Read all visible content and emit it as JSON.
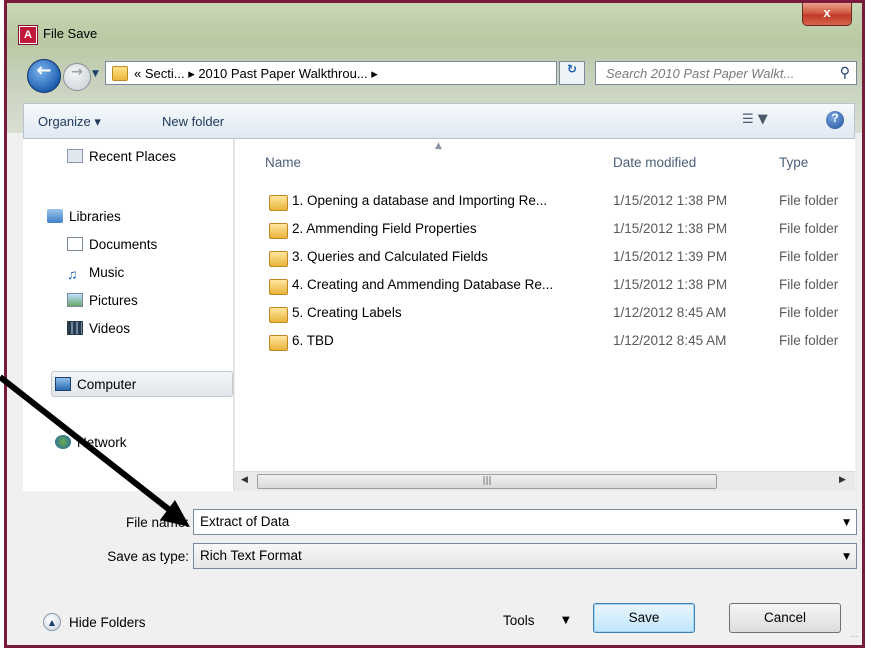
{
  "window": {
    "title": "File Save",
    "app_icon_letter": "A",
    "close_label": "x"
  },
  "address": {
    "path": "« Secti... ▸ 2010 Past Paper Walkthrou... ▸",
    "search_placeholder": "Search 2010 Past Paper Walkt..."
  },
  "toolbar": {
    "organize_label": "Organize ▾",
    "new_folder_label": "New folder"
  },
  "nav": {
    "recent_places": "Recent Places",
    "libraries": "Libraries",
    "documents": "Documents",
    "music": "Music",
    "pictures": "Pictures",
    "videos": "Videos",
    "computer": "Computer",
    "network": "Network"
  },
  "columns": {
    "name": "Name",
    "date_modified": "Date modified",
    "type": "Type"
  },
  "files": [
    {
      "name": "1. Opening a database and Importing Re...",
      "date": "1/15/2012 1:38 PM",
      "type": "File folder"
    },
    {
      "name": "2. Ammending Field Properties",
      "date": "1/15/2012 1:38 PM",
      "type": "File folder"
    },
    {
      "name": "3. Queries and Calculated Fields",
      "date": "1/15/2012 1:39 PM",
      "type": "File folder"
    },
    {
      "name": "4. Creating and Ammending Database Re...",
      "date": "1/15/2012 1:38 PM",
      "type": "File folder"
    },
    {
      "name": "5. Creating Labels",
      "date": "1/12/2012 8:45 AM",
      "type": "File folder"
    },
    {
      "name": "6. TBD",
      "date": "1/12/2012 8:45 AM",
      "type": "File folder"
    }
  ],
  "form": {
    "file_name_label": "File name:",
    "file_name_value": "Extract of Data",
    "save_type_label": "Save as type:",
    "save_type_value": "Rich Text Format"
  },
  "footer": {
    "hide_folders_label": "Hide Folders",
    "tools_label": "Tools",
    "save_label": "Save",
    "cancel_label": "Cancel"
  },
  "colors": {
    "frame_border": "#7a1a3a",
    "annotation_arrow": "#000000",
    "accent": "#1f5fb0"
  }
}
